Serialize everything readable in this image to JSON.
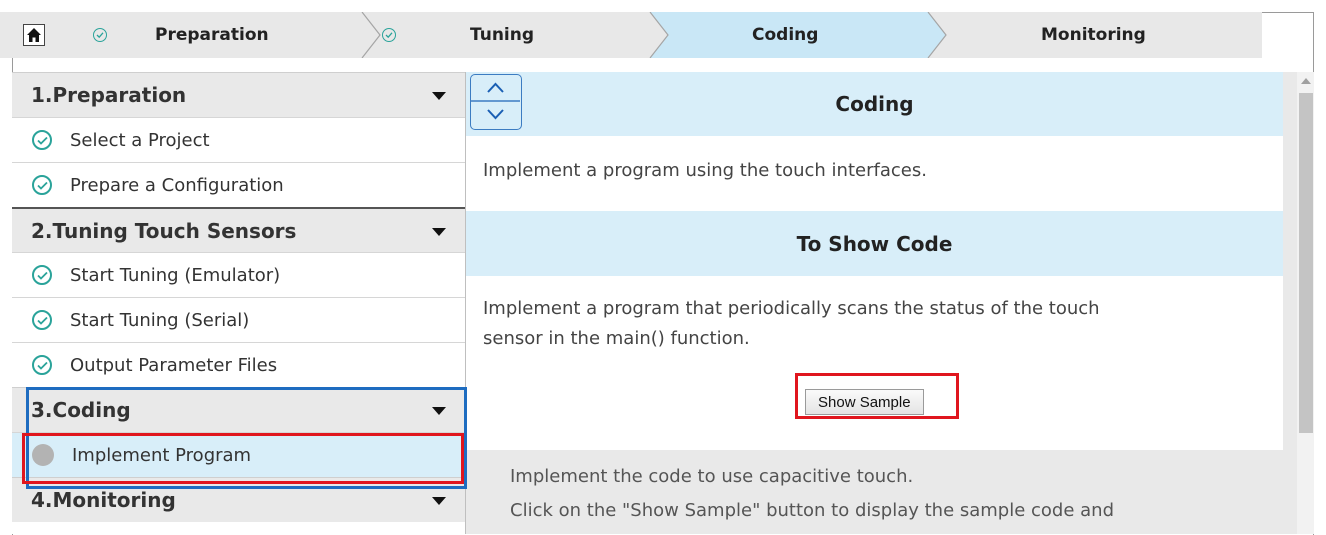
{
  "steps": {
    "home_icon": "home-icon",
    "preparation": "Preparation",
    "tuning": "Tuning",
    "coding": "Coding",
    "monitoring": "Monitoring"
  },
  "sidebar": {
    "sections": [
      {
        "label": "1.Preparation"
      },
      {
        "label": "2.Tuning Touch Sensors"
      },
      {
        "label": "3.Coding"
      },
      {
        "label": "4.Monitoring"
      }
    ],
    "items": [
      {
        "label": "Select a Project",
        "status": "done"
      },
      {
        "label": "Prepare a Configuration",
        "status": "done"
      },
      {
        "label": "Start Tuning (Emulator)",
        "status": "done"
      },
      {
        "label": "Start Tuning (Serial)",
        "status": "done"
      },
      {
        "label": "Output Parameter Files",
        "status": "done"
      },
      {
        "label": "Implement Program",
        "status": "pending"
      }
    ]
  },
  "main": {
    "coding_title": "Coding",
    "coding_desc": "Implement a program using the touch interfaces.",
    "show_code_title": "To Show Code",
    "show_code_desc_line1": "Implement a program that periodically scans the status of the touch",
    "show_code_desc_line2": "sensor in the main() function.",
    "show_sample_button": "Show Sample",
    "footer_line1": "Implement the code to use capacitive touch.",
    "footer_line2": "Click on the \"Show Sample\" button to display the sample code and"
  },
  "colors": {
    "accent_teal": "#2aa39a",
    "highlight_red": "#e0161e",
    "highlight_blue": "#1e6cc0",
    "active_step": "#c9e7f6"
  }
}
